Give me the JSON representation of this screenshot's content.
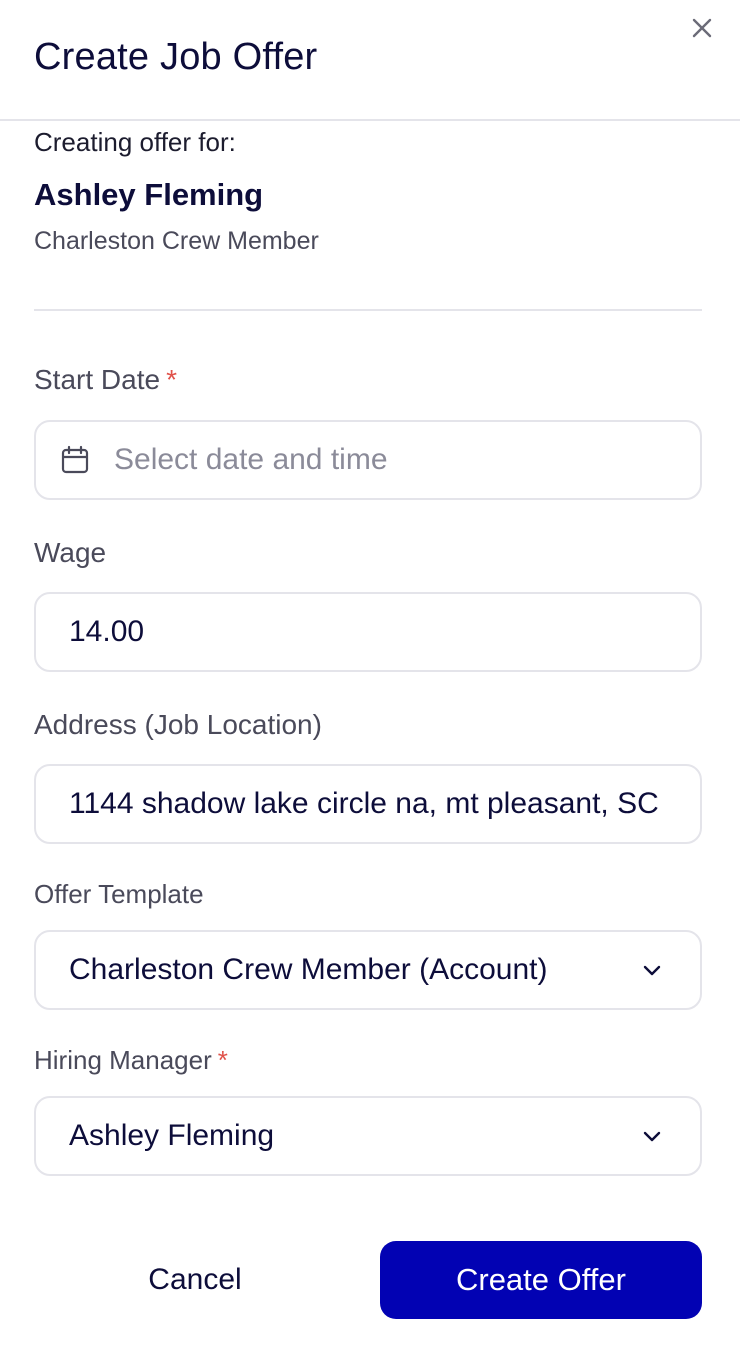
{
  "modal": {
    "title": "Create Job Offer",
    "close_icon": "close-icon"
  },
  "candidate": {
    "intro": "Creating offer for:",
    "name": "Ashley Fleming",
    "role": "Charleston Crew Member"
  },
  "form": {
    "start_date": {
      "label": "Start Date",
      "required_mark": "*",
      "placeholder": "Select date and time",
      "icon": "calendar-icon"
    },
    "wage": {
      "label": "Wage",
      "value": "14.00"
    },
    "address": {
      "label": "Address (Job Location)",
      "value": "1144 shadow lake circle na, mt pleasant, SC"
    },
    "offer_template": {
      "label": "Offer Template",
      "value": "Charleston Crew Member (Account)",
      "icon": "chevron-down-icon"
    },
    "hiring_manager": {
      "label": "Hiring Manager",
      "required_mark": "*",
      "value": "Ashley Fleming",
      "icon": "chevron-down-icon"
    }
  },
  "actions": {
    "cancel_label": "Cancel",
    "create_label": "Create Offer"
  },
  "colors": {
    "primary": "#0202b3",
    "required": "#e0524a",
    "border": "#e4e4ea",
    "text_dark": "#0d0d3a",
    "text_muted": "#4a4a5a",
    "placeholder": "#8b8b99"
  }
}
